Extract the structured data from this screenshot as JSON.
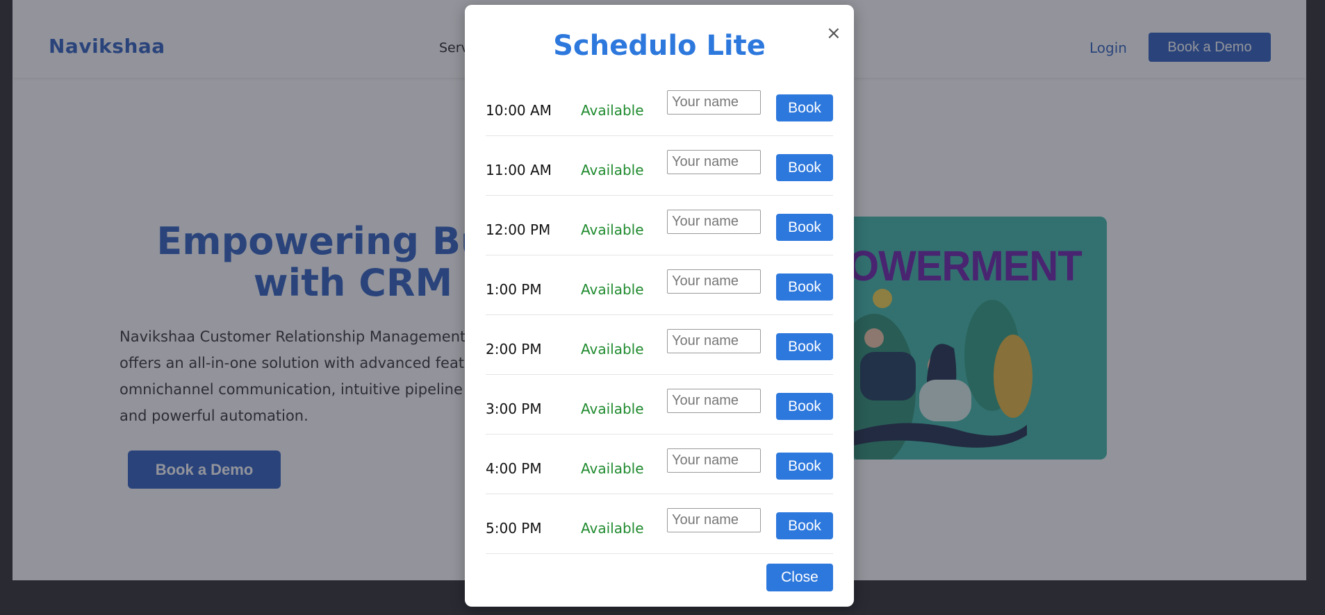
{
  "nav": {
    "brand": "Navikshaa",
    "link_partial": "Serv",
    "login": "Login",
    "demo_button": "Book a Demo"
  },
  "hero": {
    "title": "Empowering Busin\nwith CRM",
    "text": "Navikshaa Customer Relationship Management\noffers an all-in-one solution with advanced featu\nomnichannel communication, intuitive pipeline m\nand powerful automation.",
    "button": "Book a Demo",
    "image_word": "OWERMENT"
  },
  "modal": {
    "title": "Schedulo Lite",
    "close_icon": "×",
    "close_button": "Close",
    "slots": [
      {
        "time": "10:00 AM",
        "status": "Available",
        "placeholder": "Your name",
        "button": "Book"
      },
      {
        "time": "11:00 AM",
        "status": "Available",
        "placeholder": "Your name",
        "button": "Book"
      },
      {
        "time": "12:00 PM",
        "status": "Available",
        "placeholder": "Your name",
        "button": "Book"
      },
      {
        "time": "1:00 PM",
        "status": "Available",
        "placeholder": "Your name",
        "button": "Book"
      },
      {
        "time": "2:00 PM",
        "status": "Available",
        "placeholder": "Your name",
        "button": "Book"
      },
      {
        "time": "3:00 PM",
        "status": "Available",
        "placeholder": "Your name",
        "button": "Book"
      },
      {
        "time": "4:00 PM",
        "status": "Available",
        "placeholder": "Your name",
        "button": "Book"
      },
      {
        "time": "5:00 PM",
        "status": "Available",
        "placeholder": "Your name",
        "button": "Book"
      }
    ]
  },
  "colors": {
    "brand_blue": "#2d5fbf",
    "modal_blue": "#2d78dd",
    "available_green": "#1f8a2e",
    "image_teal": "#3cb8a8",
    "image_text_purple": "#6a1ea8"
  }
}
